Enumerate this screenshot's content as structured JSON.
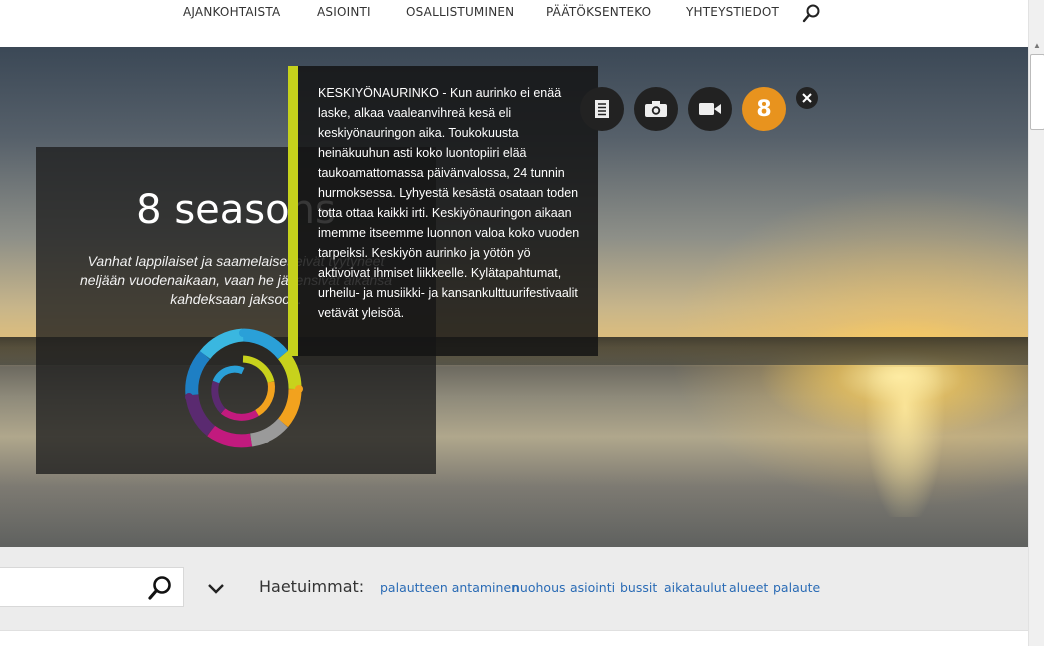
{
  "nav": {
    "items": [
      "AJANKOHTAISTA",
      "ASIOINTI",
      "OSALLISTUMINEN",
      "PÄÄTÖKSENTEKO",
      "YHTEYSTIEDOT"
    ],
    "search_icon": "search-icon"
  },
  "hero": {
    "title": "8 seasons",
    "description": "Vanhat lappilaiset ja saamelaiset eivät tyytyneet neljään vuodenaikaan, vaan he jäsensivät aikansa kahdeksaan jaksoon.",
    "info_text": "KESKIYÖNAURINKO - Kun aurinko ei enää laske, alkaa vaaleanvihreä kesä eli keskiyönauringon aika. Toukokuusta heinäkuuhun asti koko luontopiiri elää taukoamattomassa päivänvalossa, 24 tunnin hurmoksessa. Lyhyestä kesästä osataan toden totta ottaa kaikki irti. Keskiyönauringon aikaan imemme itseemme luonnon valoa koko vuoden tarpeiksi. Keskiyön aurinko ja yötön yö aktivoivat ihmiset liikkeelle. Kylätapahtumat, urheilu- ja musiikki- ja kansankulttuurifestivaalit vetävät yleisöä.",
    "buttons": {
      "text_icon": "document-icon",
      "camera_icon": "camera-icon",
      "video_icon": "video-camera-icon",
      "season_number": "8",
      "close_icon": "close-icon"
    },
    "accent_color": "#c5d11c",
    "season_color": "#e8931e"
  },
  "search": {
    "placeholder": "",
    "popular_label": "Haetuimmat:",
    "popular_links": [
      "palautteen antaminen",
      "nuohous",
      "asiointi",
      "bussit",
      "aikataulut",
      "alueet",
      "palaute"
    ],
    "link_color": "#2a6bb5"
  }
}
